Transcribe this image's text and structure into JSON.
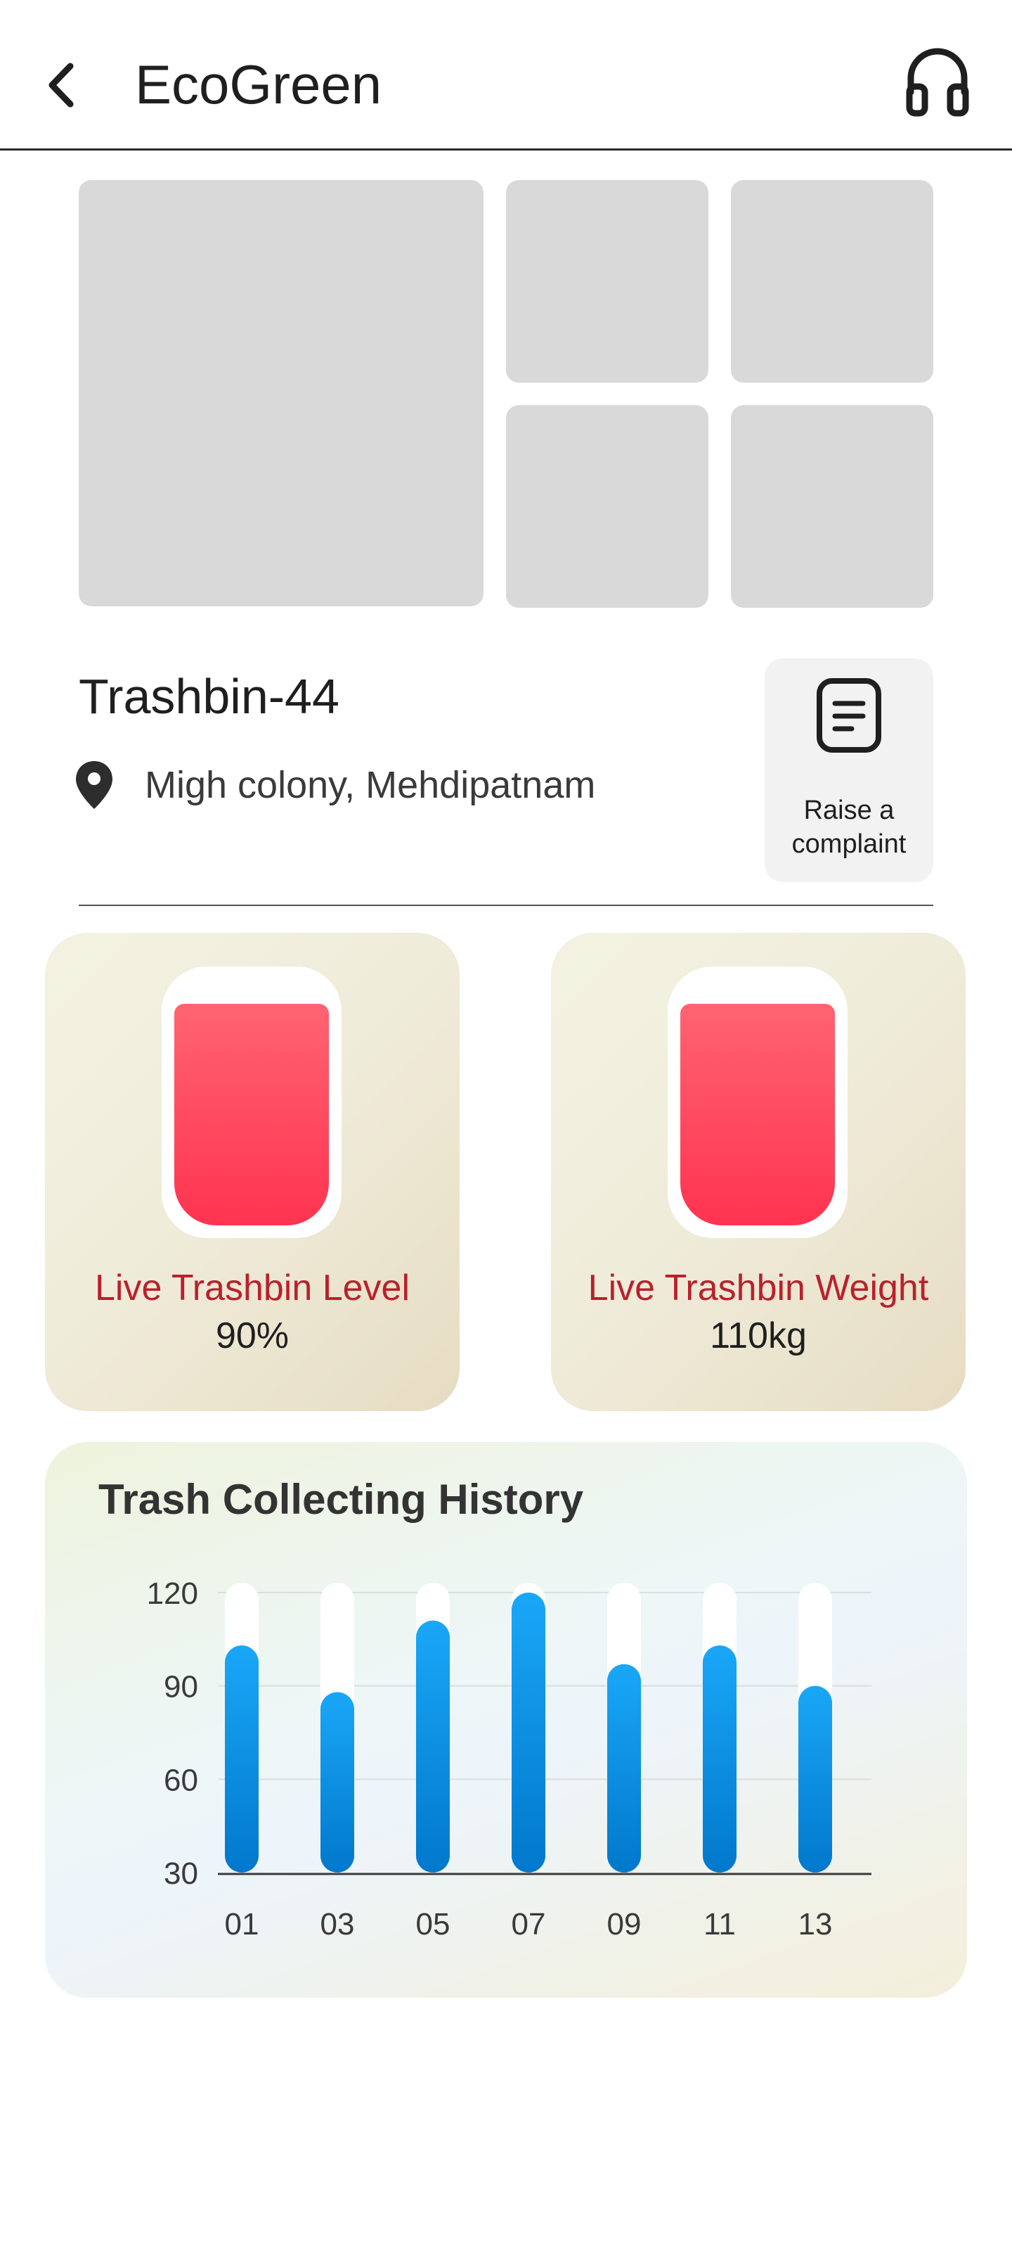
{
  "header": {
    "title": "EcoGreen",
    "back_icon": "chevron-left-icon",
    "support_icon": "headset-icon"
  },
  "gallery": {
    "image_count": 5
  },
  "bin": {
    "name": "Trashbin-44",
    "location_icon": "map-pin-icon",
    "location": "Migh colony, Mehdipatnam"
  },
  "complaint": {
    "icon": "document-icon",
    "label_line1": "Raise a",
    "label_line2": "complaint"
  },
  "live_cards": [
    {
      "label": "Live Trashbin Level",
      "value": "90%",
      "fill_fraction": 0.9
    },
    {
      "label": "Live Trashbin Weight",
      "value": "110kg",
      "fill_fraction": 0.9
    }
  ],
  "history": {
    "title": "Trash Collecting History"
  },
  "colors": {
    "accent_red": "#b9212c",
    "bar_blue": "#1aa3f5",
    "bin_fill": "#ff4860"
  },
  "chart_data": {
    "type": "bar",
    "categories": [
      "01",
      "03",
      "05",
      "07",
      "09",
      "11",
      "13"
    ],
    "values": [
      103,
      88,
      111,
      120,
      97,
      103,
      90
    ],
    "ylim": [
      30,
      120
    ],
    "yticks": [
      30,
      60,
      90,
      120
    ],
    "grid": true,
    "title": "Trash Collecting History"
  }
}
